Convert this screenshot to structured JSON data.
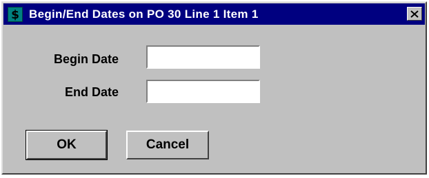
{
  "window": {
    "title": "Begin/End Dates on PO 30 Line 1 Item 1",
    "app_icon_glyph": "$",
    "app_icon_name": "dollar-icon",
    "close_icon_name": "close-icon"
  },
  "form": {
    "begin_label": "Begin Date",
    "begin_value": "",
    "end_label": "End Date",
    "end_value": ""
  },
  "buttons": {
    "ok_label": "OK",
    "cancel_label": "Cancel"
  },
  "colors": {
    "titlebar": "#000080",
    "face": "#c0c0c0",
    "app_icon": "#008080"
  }
}
